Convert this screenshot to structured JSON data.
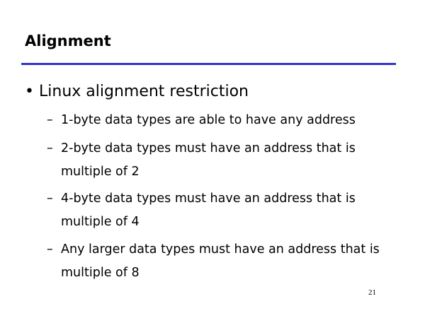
{
  "slide": {
    "title": "Alignment",
    "accent_color": "#3333cc",
    "bullet": "Linux alignment restriction",
    "sub_items": [
      "1-byte data types are able to have any address",
      "2-byte data types must have an address that is multiple of 2",
      "4-byte data types must have an address that is multiple of 4",
      "Any larger data types must have an address that is multiple of 8"
    ],
    "page_number": "21"
  }
}
